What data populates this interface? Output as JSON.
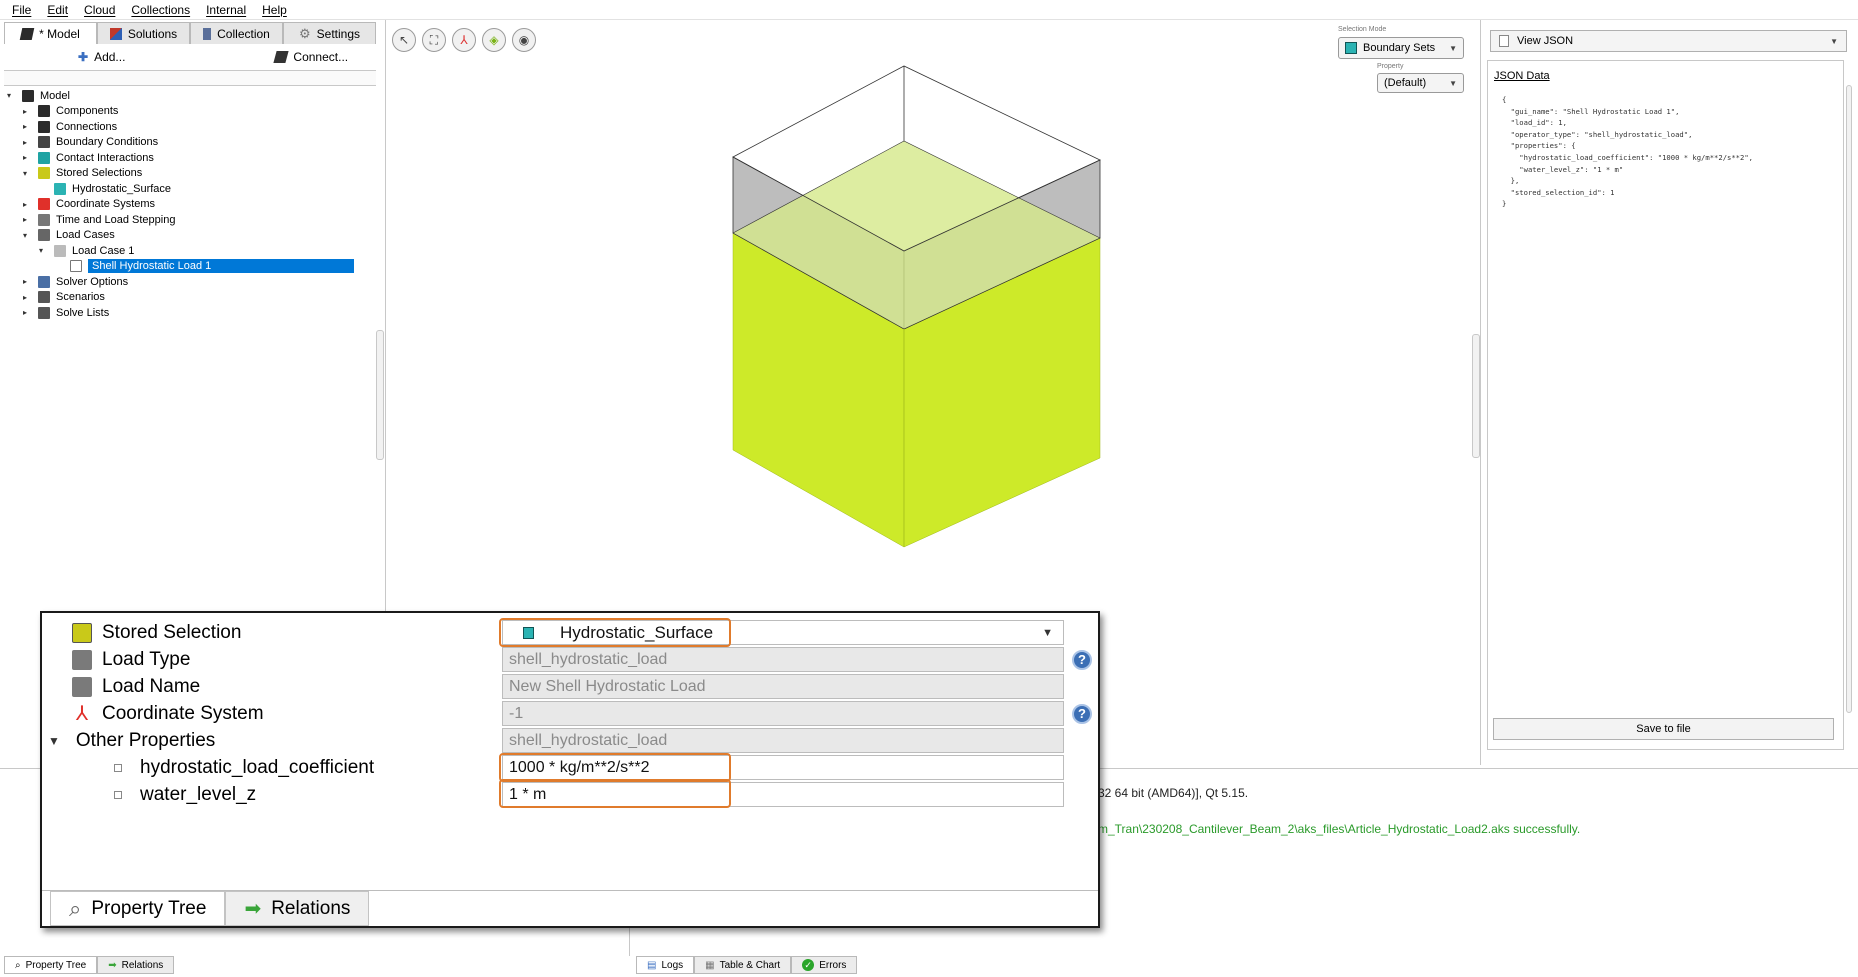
{
  "menu": [
    "File",
    "Edit",
    "Cloud",
    "Collections",
    "Internal",
    "Help"
  ],
  "main_tabs": [
    {
      "label": "* Model",
      "icon": "model-icon",
      "color": "#2b2b2b"
    },
    {
      "label": "Solutions",
      "icon": "solutions-icon",
      "color": "#c0392b"
    },
    {
      "label": "Collection",
      "icon": "collection-icon",
      "color": "#5a6f9a"
    },
    {
      "label": "Settings",
      "icon": "gear-icon",
      "color": "#777777"
    }
  ],
  "toolbar": {
    "add_label": "Add...",
    "connect_label": "Connect..."
  },
  "tree": [
    {
      "label": "Model",
      "arrow": "▾",
      "icon_color": "#2b2b2b"
    },
    {
      "label": "Components",
      "arrow": "▸",
      "icon_color": "#2b2b2b"
    },
    {
      "label": "Connections",
      "arrow": "▸",
      "icon_color": "#2b2b2b"
    },
    {
      "label": "Boundary Conditions",
      "arrow": "▸",
      "icon_color": "#444444"
    },
    {
      "label": "Contact Interactions",
      "arrow": "▸",
      "icon_color": "#1fa3a3"
    },
    {
      "label": "Stored Selections",
      "arrow": "▾",
      "icon_color": "#c9c919"
    },
    {
      "label": "Hydrostatic_Surface",
      "arrow": "",
      "icon_color": "#2bb3b3"
    },
    {
      "label": "Coordinate Systems",
      "arrow": "▸",
      "icon_color": "#e0302a"
    },
    {
      "label": "Time and Load Stepping",
      "arrow": "▸",
      "icon_color": "#777777"
    },
    {
      "label": "Load Cases",
      "arrow": "▾",
      "icon_color": "#666666"
    },
    {
      "label": "Load Case 1",
      "arrow": "▾",
      "icon_color": "#bbbbbb"
    },
    {
      "label": "Shell Hydrostatic Load 1",
      "arrow": "",
      "icon_color": "#ffffff"
    },
    {
      "label": "Solver Options",
      "arrow": "▸",
      "icon_color": "#4a6fa5"
    },
    {
      "label": "Scenarios",
      "arrow": "▸",
      "icon_color": "#555555"
    },
    {
      "label": "Solve Lists",
      "arrow": "▸",
      "icon_color": "#555555"
    }
  ],
  "viewport": {
    "selection_mode_label": "Selection Mode",
    "selection_mode_value": "Boundary Sets",
    "property_label": "Property",
    "property_value": "(Default)",
    "accent_fill": "#cdea29",
    "top_fill": "#b9b9b9"
  },
  "json_panel": {
    "combo_label": "View JSON",
    "title": "JSON Data",
    "code": "{\n  \"gui_name\": \"Shell Hydrostatic Load 1\",\n  \"load_id\": 1,\n  \"operator_type\": \"shell_hydrostatic_load\",\n  \"properties\": {\n    \"hydrostatic_load_coefficient\": \"1000 * kg/m**2/s**2\",\n    \"water_level_z\": \"1 * m\"\n  },\n  \"stored_selection_id\": 1\n}",
    "save_label": "Save to file"
  },
  "log": {
    "line1": "32 64 bit (AMD64)], Qt 5.15.",
    "line2": "m_Tran\\230208_Cantilever_Beam_2\\aks_files\\Article_Hydrostatic_Load2.aks successfully."
  },
  "bottom_tabs_left": [
    "Property Tree",
    "Relations"
  ],
  "bottom_tabs_right": [
    "Logs",
    "Table & Chart",
    "Errors"
  ],
  "inset": {
    "rows": [
      {
        "name": "Stored Selection",
        "value": "Hydrostatic_Surface"
      },
      {
        "name": "Load Type",
        "value": "shell_hydrostatic_load"
      },
      {
        "name": "Load Name",
        "value": "New Shell Hydrostatic Load"
      },
      {
        "name": "Coordinate System",
        "value": "-1"
      },
      {
        "name": "Other Properties",
        "value": "shell_hydrostatic_load"
      },
      {
        "name": "hydrostatic_load_coefficient",
        "value": "1000 * kg/m**2/s**2"
      },
      {
        "name": "water_level_z",
        "value": "1 * m"
      }
    ],
    "tabs": [
      "Property Tree",
      "Relations"
    ],
    "highlight_color": "#e07b2c"
  }
}
